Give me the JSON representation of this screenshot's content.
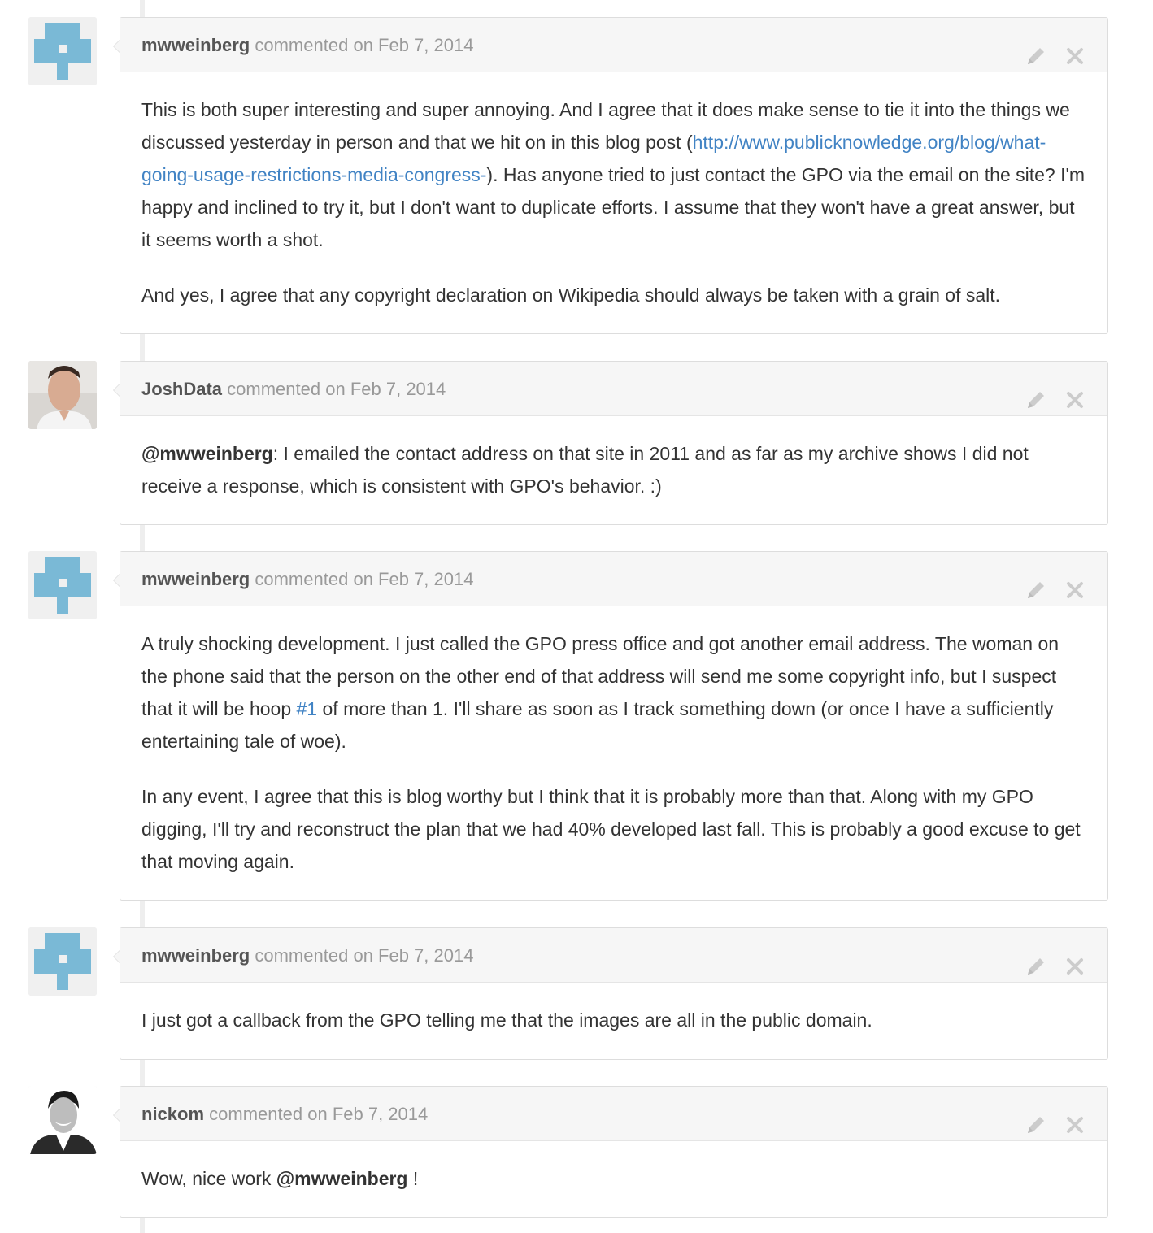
{
  "comments": [
    {
      "author": "mwweinberg",
      "verb": "commented",
      "date": "on Feb 7, 2014",
      "avatar": "identicon-avatar",
      "p1_a": "This is both super interesting and super annoying. And I agree that it does make sense to tie it into the things we discussed yesterday in person and that we hit on in this blog post (",
      "p1_link": "http://www.publicknowledge.org/blog/what-going-usage-restrictions-media-congress-",
      "p1_b": "). Has anyone tried to just contact the GPO via the email on the site? I'm happy and inclined to try it, but I don't want to duplicate efforts. I assume that they won't have a great answer, but it seems worth a shot.",
      "p2": "And yes, I agree that any copyright declaration on Wikipedia should always be taken with a grain of salt."
    },
    {
      "author": "JoshData",
      "verb": "commented",
      "date": "on Feb 7, 2014",
      "avatar": "photo-avatar",
      "mention": "@mwweinberg",
      "p1": ": I emailed the contact address on that site in 2011 and as far as my archive shows I did not receive a response, which is consistent with GPO's behavior. :)"
    },
    {
      "author": "mwweinberg",
      "verb": "commented",
      "date": "on Feb 7, 2014",
      "avatar": "identicon-avatar",
      "p1_a": "A truly shocking development. I just called the GPO press office and got another email address. The woman on the phone said that the person on the other end of that address will send me some copyright info, but I suspect that it will be hoop ",
      "p1_link": "#1",
      "p1_b": " of more than 1. I'll share as soon as I track something down (or once I have a sufficiently entertaining tale of woe).",
      "p2": "In any event, I agree that this is blog worthy but I think that it is probably more than that. Along with my GPO digging, I'll try and reconstruct the plan that we had 40% developed last fall. This is probably a good excuse to get that moving again."
    },
    {
      "author": "mwweinberg",
      "verb": "commented",
      "date": "on Feb 7, 2014",
      "avatar": "identicon-avatar",
      "p1": "I just got a callback from the GPO telling me that the images are all in the public domain."
    },
    {
      "author": "nickom",
      "verb": "commented",
      "date": "on Feb 7, 2014",
      "avatar": "photo-avatar",
      "p1_a": "Wow, nice work ",
      "mention": "@mwweinberg",
      "p1_b": " !"
    }
  ],
  "icons": {
    "edit": "pencil-icon",
    "delete": "close-icon"
  },
  "colors": {
    "link": "#4183c4",
    "identicon": "#7ab9d6",
    "header_bg": "#f6f6f6",
    "border": "#dddddd"
  }
}
